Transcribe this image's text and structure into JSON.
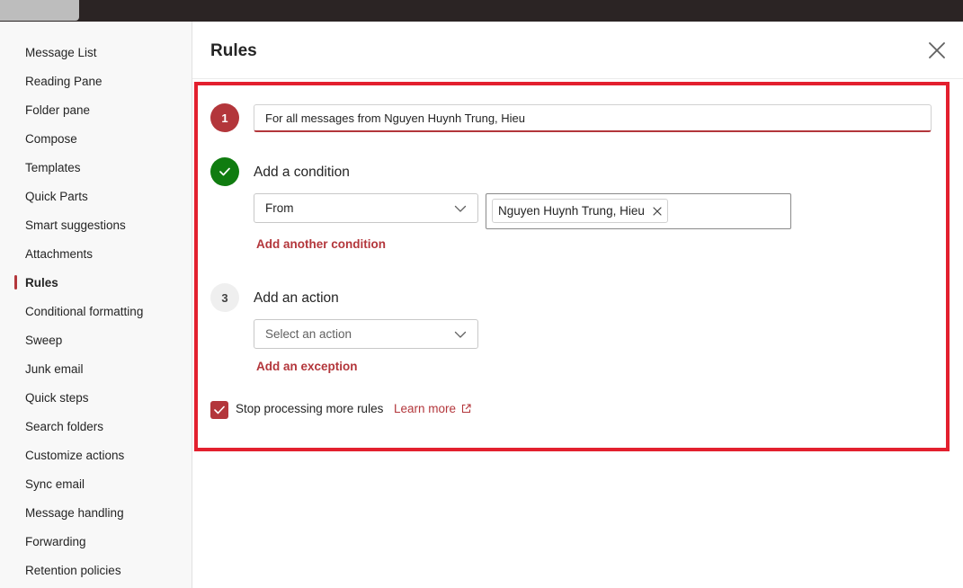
{
  "sidebar": {
    "items": [
      {
        "label": "Message List"
      },
      {
        "label": "Reading Pane"
      },
      {
        "label": "Folder pane"
      },
      {
        "label": "Compose"
      },
      {
        "label": "Templates"
      },
      {
        "label": "Quick Parts"
      },
      {
        "label": "Smart suggestions"
      },
      {
        "label": "Attachments"
      },
      {
        "label": "Rules"
      },
      {
        "label": "Conditional formatting"
      },
      {
        "label": "Sweep"
      },
      {
        "label": "Junk email"
      },
      {
        "label": "Quick steps"
      },
      {
        "label": "Search folders"
      },
      {
        "label": "Customize actions"
      },
      {
        "label": "Sync email"
      },
      {
        "label": "Message handling"
      },
      {
        "label": "Forwarding"
      },
      {
        "label": "Retention policies"
      }
    ],
    "active_item": "Rules"
  },
  "header": {
    "title": "Rules",
    "close_icon": "close-icon"
  },
  "form": {
    "step1": {
      "number": "1",
      "rule_name_value": "For all messages from Nguyen Huynh Trung, Hieu"
    },
    "step2": {
      "icon": "checkmark-icon",
      "title": "Add a condition",
      "condition_selected": "From",
      "recipient_chip": "Nguyen Huynh Trung, Hieu",
      "add_condition_link": "Add another condition"
    },
    "step3": {
      "number": "3",
      "title": "Add an action",
      "action_placeholder": "Select an action",
      "add_exception_link": "Add an exception"
    },
    "stop_processing": {
      "checked": true,
      "label": "Stop processing more rules",
      "learn_more": "Learn more"
    }
  },
  "colors": {
    "accent": "#b3363b",
    "success": "#107c10",
    "highlight": "#e3202e"
  }
}
